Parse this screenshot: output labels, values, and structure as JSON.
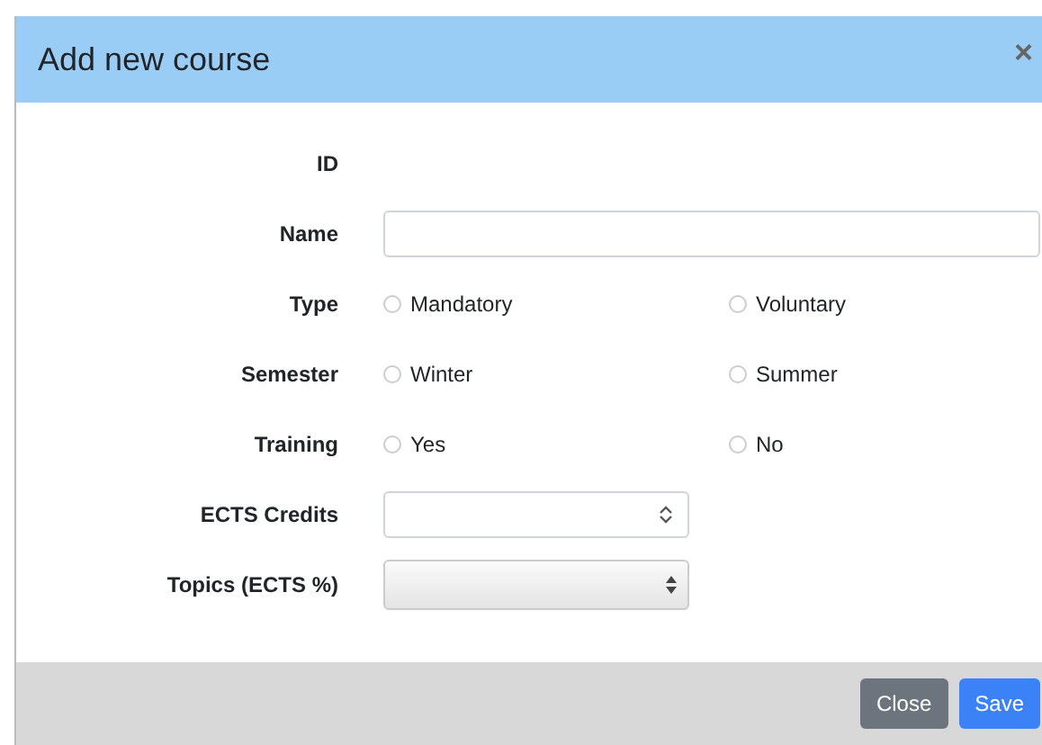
{
  "dialog": {
    "title": "Add new course",
    "close": "×"
  },
  "fields": [
    {
      "kind": "static",
      "label": "ID"
    },
    {
      "kind": "text",
      "label": "Name"
    },
    {
      "kind": "radio",
      "label": "Type",
      "options": [
        {
          "label": "Mandatory",
          "selected": false
        },
        {
          "label": "Voluntary",
          "selected": false
        }
      ]
    },
    {
      "kind": "radio",
      "label": "Semester",
      "options": [
        {
          "label": "Winter",
          "selected": false
        },
        {
          "label": "Summer",
          "selected": false
        }
      ]
    },
    {
      "kind": "radio",
      "label": "Training",
      "options": [
        {
          "label": "Yes",
          "selected": false
        },
        {
          "label": "No",
          "selected": false
        }
      ]
    },
    {
      "kind": "number",
      "label": "ECTS Credits"
    },
    {
      "kind": "select",
      "label": "Topics (ECTS %)"
    }
  ],
  "buttons": [
    {
      "label": "Close",
      "kind": "secondary"
    },
    {
      "label": "Save",
      "kind": "primary"
    }
  ]
}
